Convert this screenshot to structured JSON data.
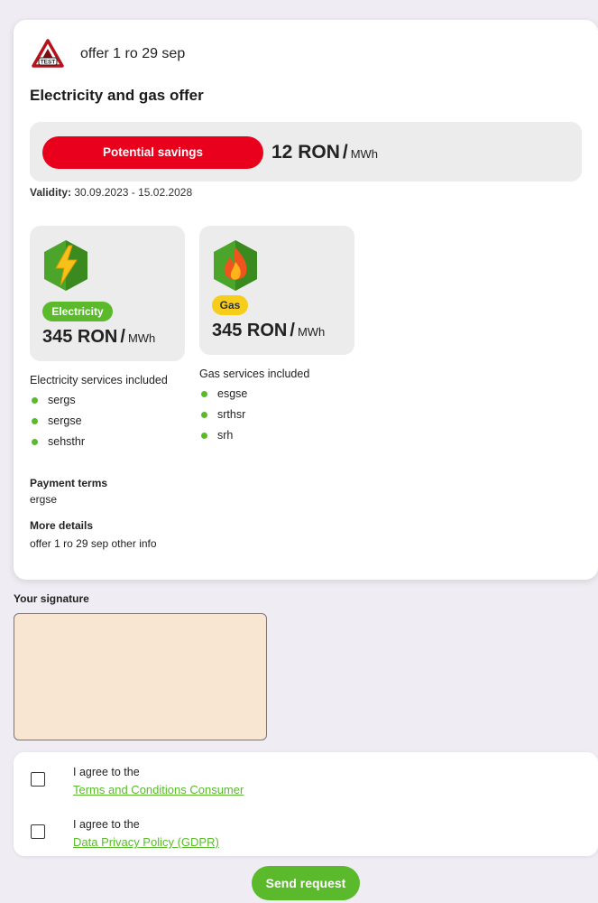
{
  "offer": {
    "title": "offer 1 ro 29 sep",
    "heading": "Electricity and gas offer",
    "logo_icon": "test-warning-triangle-logo"
  },
  "savings": {
    "label": "Potential savings",
    "value": "12 RON",
    "slash": "/",
    "unit": "MWh"
  },
  "validity": {
    "label": "Validity:",
    "value": "30.09.2023 - 15.02.2028"
  },
  "electricity": {
    "icon": "lightning-hex-icon",
    "badge": "Electricity",
    "price": "345 RON",
    "slash": "/",
    "unit": "MWh",
    "services_title": "Electricity services included",
    "services": [
      "sergs",
      "sergse",
      "sehsthr"
    ]
  },
  "gas": {
    "icon": "flame-hex-icon",
    "badge": "Gas",
    "price": "345 RON",
    "slash": "/",
    "unit": "MWh",
    "services_title": "Gas services included",
    "services": [
      "esgse",
      "srthsr",
      "srh"
    ]
  },
  "payment": {
    "label": "Payment terms",
    "value": "ergse"
  },
  "more_details": {
    "label": "More details",
    "value": "offer 1 ro 29 sep other info"
  },
  "signature": {
    "label": "Your signature"
  },
  "consents": [
    {
      "text": "I agree to the",
      "link": "Terms and Conditions Consumer",
      "checked": false
    },
    {
      "text": "I agree to the",
      "link": "Data Privacy Policy (GDPR)",
      "checked": false
    }
  ],
  "actions": {
    "send_label": "Send request"
  },
  "colors": {
    "accent_green": "#5aba2c",
    "savings_red": "#e8001c",
    "gas_yellow": "#f6cd1a",
    "signature_bg": "#f8e6d2"
  }
}
